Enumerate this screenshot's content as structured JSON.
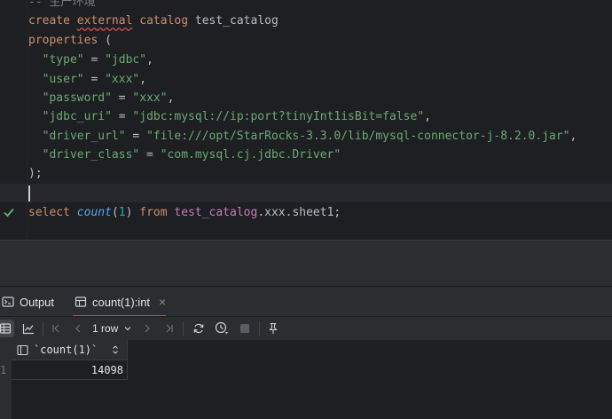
{
  "editor": {
    "comment": "-- 生产环境",
    "line_create_kw1": "create",
    "line_create_kw2": "external",
    "line_create_kw3": "catalog",
    "line_create_name": "test_catalog",
    "line_properties_kw": "properties",
    "line_properties_paren": "(",
    "properties": [
      {
        "key": "\"type\"",
        "value": "\"jdbc\"",
        "sep": ","
      },
      {
        "key": "\"user\"",
        "value": "\"xxx\"",
        "sep": ","
      },
      {
        "key": "\"password\"",
        "value": "\"xxx\"",
        "sep": ","
      },
      {
        "key": "\"jdbc_uri\"",
        "value": "\"jdbc:mysql://ip:port?tinyInt1isBit=false\"",
        "sep": ","
      },
      {
        "key": "\"driver_url\"",
        "value": "\"file:///opt/StarRocks-3.3.0/lib/mysql-connector-j-8.2.0.jar\"",
        "sep": ","
      },
      {
        "key": "\"driver_class\"",
        "value": "\"com.mysql.cj.jdbc.Driver\"",
        "sep": ""
      }
    ],
    "closing": ");",
    "select_kw": "select",
    "select_fn": "count",
    "select_arg": "1",
    "select_from": "from",
    "select_catalog": "test_catalog",
    "select_rest": ".xxx.sheet1;"
  },
  "tabs": {
    "output_label": "Output",
    "result_label": "count(1):int",
    "close_symbol": "×"
  },
  "toolbar": {
    "rows_label": "1 row"
  },
  "grid": {
    "column_header": "`count(1)`",
    "row_number": "1",
    "cell_value": "14098"
  },
  "colors": {
    "background": "#1e1f22",
    "keyword": "#cf8e6d",
    "string": "#6aab73",
    "function": "#56a8f5",
    "number": "#2aacb8",
    "identifier": "#c77dbb",
    "accent": "#3574f0",
    "success": "#5fb865"
  },
  "icons": [
    "check-icon",
    "console-icon",
    "table-icon",
    "grid-view-icon",
    "chart-icon",
    "first-page-icon",
    "prev-page-icon",
    "chevron-down-icon",
    "next-page-icon",
    "last-page-icon",
    "refresh-icon",
    "history-icon",
    "stop-icon",
    "pin-icon",
    "column-icon",
    "sort-icon"
  ]
}
